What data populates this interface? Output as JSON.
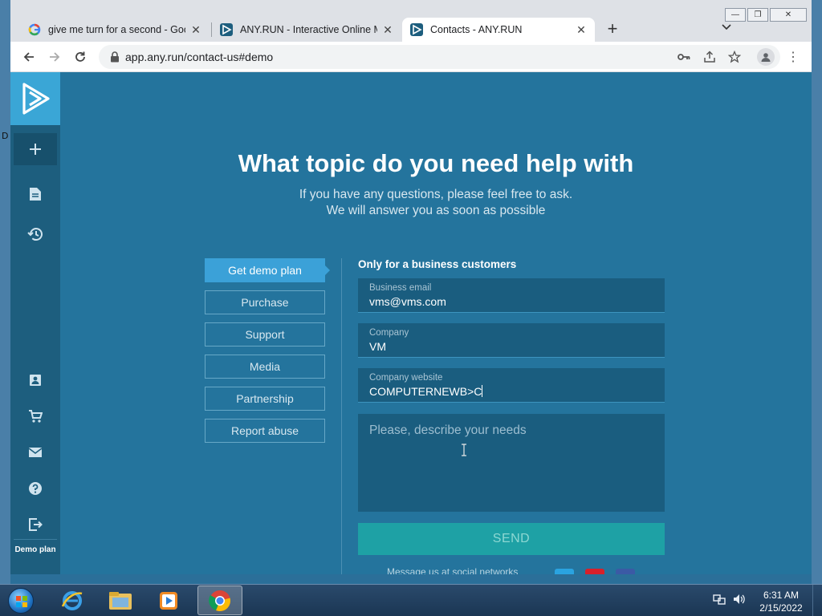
{
  "desktop": {
    "edge_char": "D"
  },
  "window": {
    "controls": {
      "minimize": "—",
      "restore": "❐",
      "close": "✕"
    }
  },
  "tabs": [
    {
      "title": "give me turn for a second - Goog",
      "favicon": "google-icon"
    },
    {
      "title": "ANY.RUN - Interactive Online Ma",
      "favicon": "anyrun-icon"
    },
    {
      "title": "Contacts - ANY.RUN",
      "favicon": "anyrun-icon",
      "active": true
    }
  ],
  "toolbar": {
    "url": "app.any.run/contact-us#demo",
    "new_tab": "+",
    "tab_menu": "⌄",
    "menu": "⋮"
  },
  "page": {
    "heading": "What topic do you need help with",
    "sub1": "If you have any questions, please feel free to ask.",
    "sub2": "We will answer you as soon as possible",
    "topics": [
      "Get demo plan",
      "Purchase",
      "Support",
      "Media",
      "Partnership",
      "Report abuse"
    ],
    "form": {
      "title": "Only for a business customers",
      "email": {
        "label": "Business email",
        "value": "vms@vms.com"
      },
      "company": {
        "label": "Company",
        "value": "VM"
      },
      "website": {
        "label": "Company website",
        "value": "COMPUTERNEWB>C"
      },
      "needs_placeholder": "Please, describe your needs",
      "send": "SEND",
      "social": "Message us at social networks"
    },
    "sidenav": {
      "demo_label": "Demo plan"
    }
  },
  "taskbar": {
    "time": "6:31 AM",
    "date": "2/15/2022"
  },
  "colors": {
    "page_bg": "#24749d",
    "sidenav": "#1d5e7e",
    "accent": "#3ba1d8",
    "send": "#1ea1a5"
  }
}
